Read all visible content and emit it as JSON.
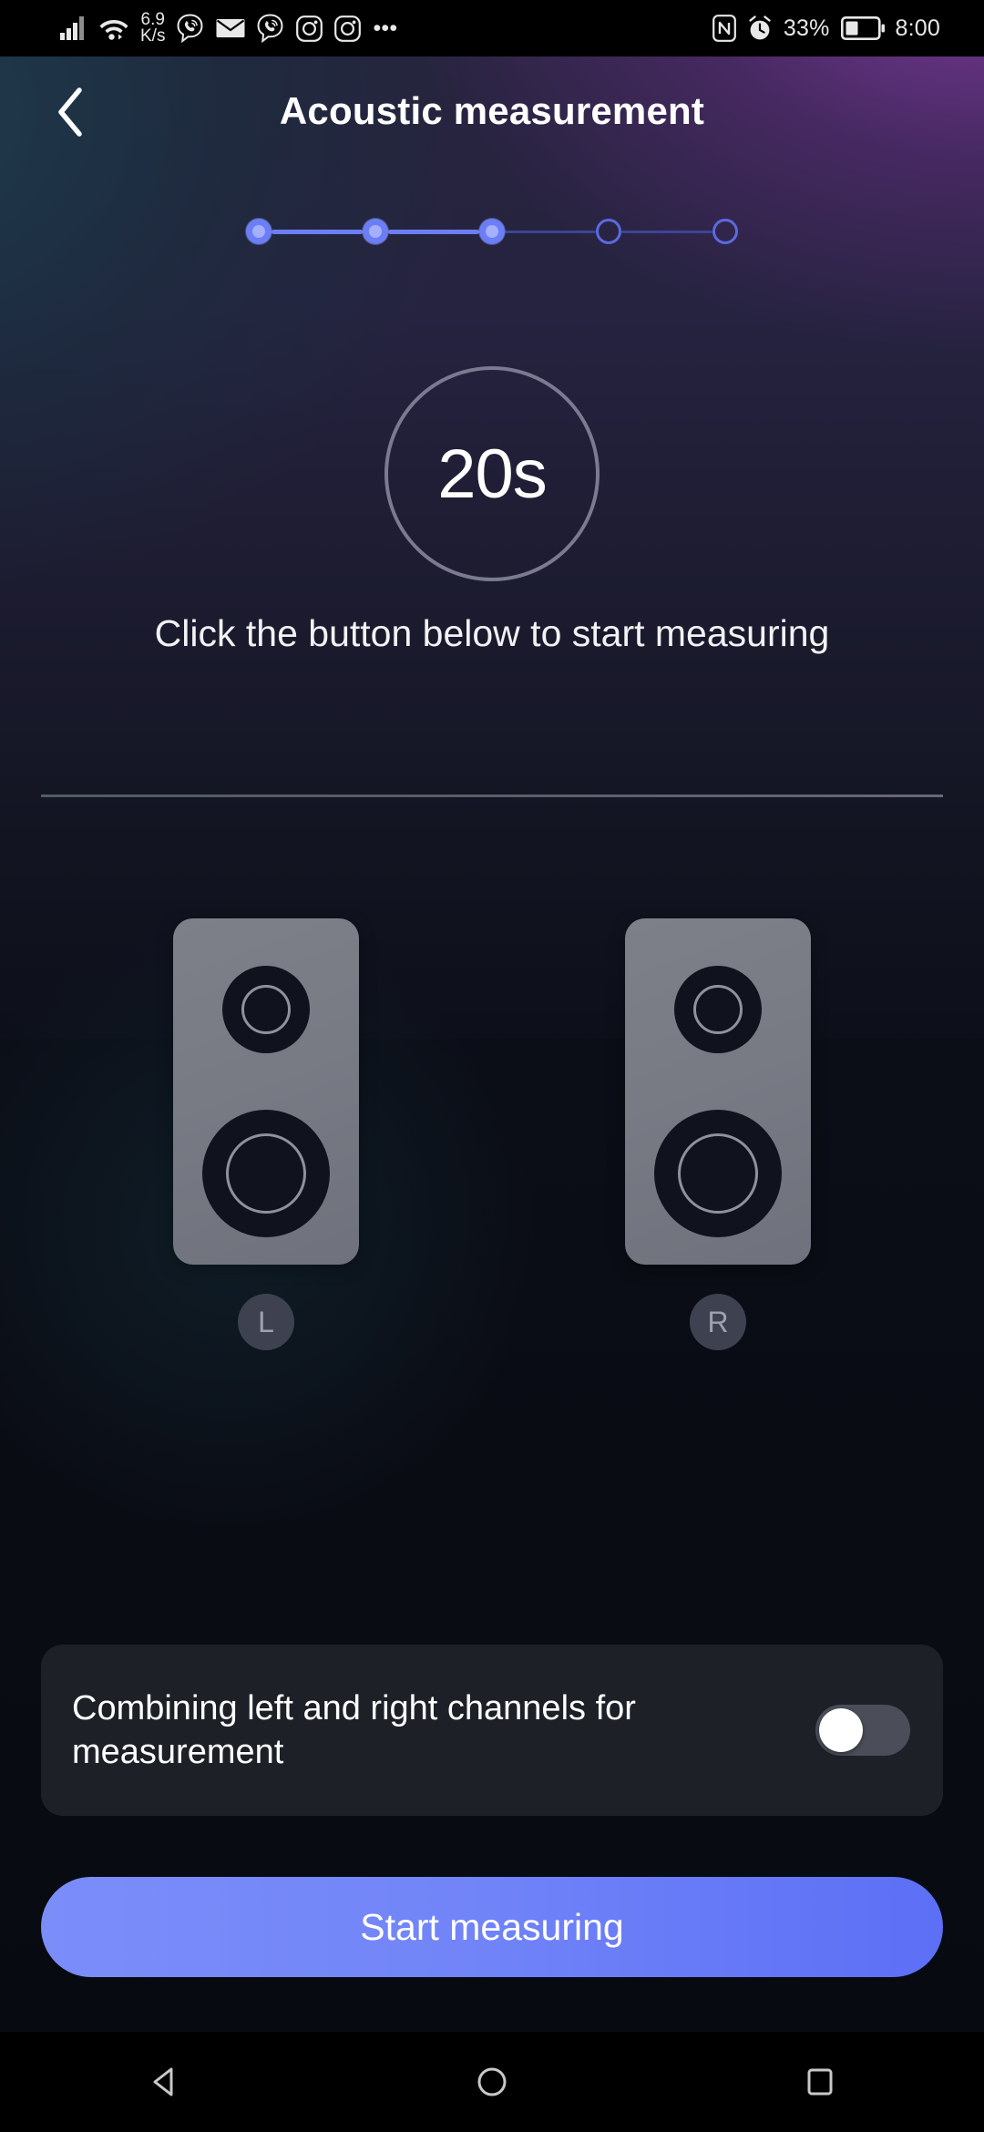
{
  "status_bar": {
    "left_icons": [
      "signal-bars-icon",
      "wifi-icon"
    ],
    "network_rate_value": "6.9",
    "network_rate_unit": "K/s",
    "notification_icons": [
      "viber-icon",
      "mail-icon",
      "viber-icon",
      "instagram-icon",
      "instagram-icon"
    ],
    "overflow": "•••",
    "nfc_icon": "nfc-icon",
    "alarm_icon": "alarm-clock-icon",
    "battery_percent": "33%",
    "battery_icon": "battery-icon",
    "clock": "8:00"
  },
  "header": {
    "back_icon": "chevron-left-icon",
    "title": "Acoustic measurement"
  },
  "stepper": {
    "total_steps": 5,
    "current_step": 3,
    "steps": [
      {
        "index": 1,
        "state": "done"
      },
      {
        "index": 2,
        "state": "done"
      },
      {
        "index": 3,
        "state": "done"
      },
      {
        "index": 4,
        "state": "todo"
      },
      {
        "index": 5,
        "state": "todo"
      }
    ],
    "active_color": "#6b7ef5",
    "inactive_color": "#3c4496"
  },
  "timer": {
    "value": "20s",
    "ring_color": "#7b7a90"
  },
  "instruction": {
    "text": "Click the button below to start measuring"
  },
  "speakers": [
    {
      "channel": "L",
      "badge": "L",
      "name": "left-speaker"
    },
    {
      "channel": "R",
      "badge": "R",
      "name": "right-speaker"
    }
  ],
  "toggle_card": {
    "label": "Combining left and right channels for measurement",
    "state": "off",
    "track_color": "#4b4e58",
    "knob_color": "#ffffff"
  },
  "primary_button": {
    "label": "Start measuring",
    "color_start": "#7b8df9",
    "color_end": "#5c6ff6"
  },
  "nav_bar": {
    "back": "nav-back-icon",
    "home": "nav-home-icon",
    "recents": "nav-recents-icon"
  }
}
